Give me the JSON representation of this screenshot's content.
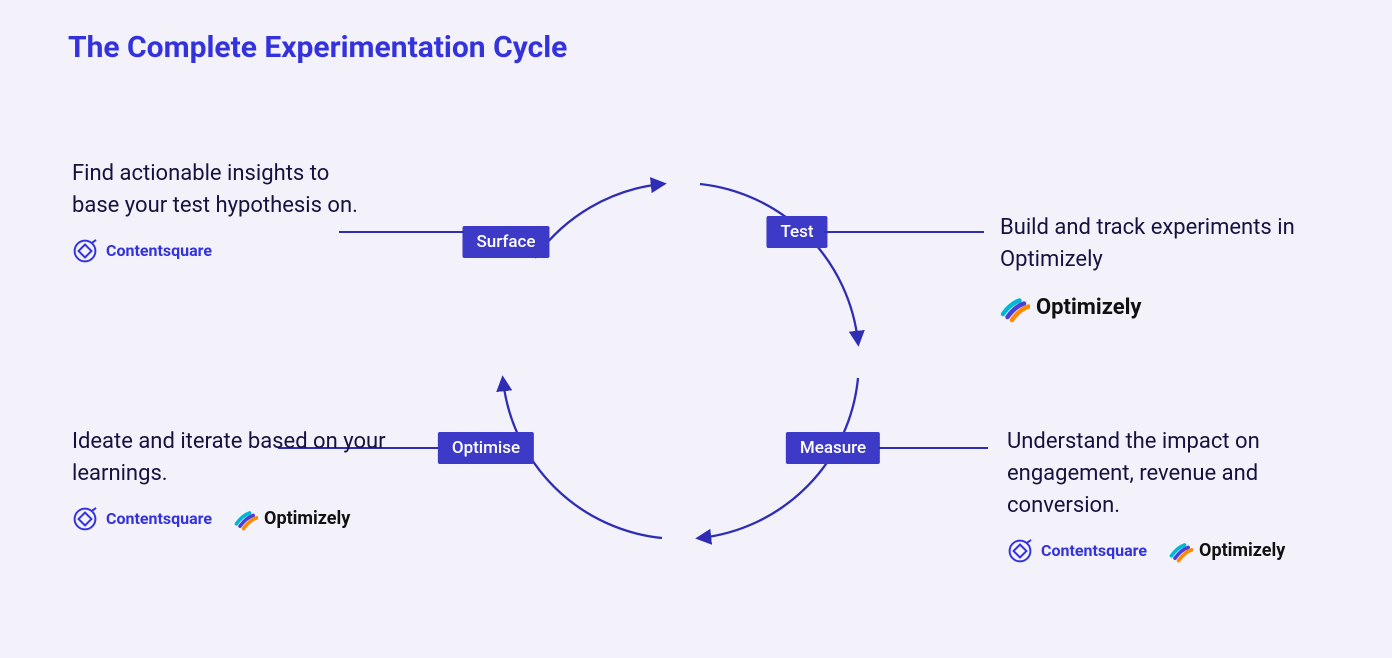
{
  "title": "The Complete Experimentation Cycle",
  "nodes": {
    "surface": "Surface",
    "test": "Test",
    "measure": "Measure",
    "optimise": "Optimise"
  },
  "blocks": {
    "surface": {
      "text": "Find actionable insights to base your test hypothesis on.",
      "logos": [
        "Contentsquare"
      ]
    },
    "test": {
      "text": "Build and track experiments in Optimizely",
      "logos": [
        "Optimizely"
      ]
    },
    "measure": {
      "text": "Understand the impact on engagement, revenue and conversion.",
      "logos": [
        "Contentsquare",
        "Optimizely"
      ]
    },
    "optimise": {
      "text": "Ideate and iterate based on your learnings.",
      "logos": [
        "Contentsquare",
        "Optimizely"
      ]
    }
  },
  "brands": {
    "contentsquare": "Contentsquare",
    "optimizely": "Optimizely"
  },
  "colors": {
    "accent": "#3432dd",
    "node": "#3d3ac7",
    "text": "#16123f",
    "bg": "#f3f2fb"
  }
}
